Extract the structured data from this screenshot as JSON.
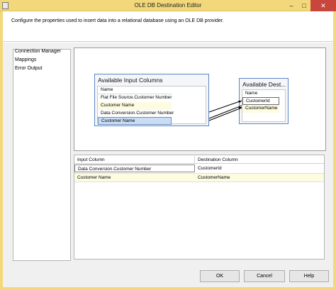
{
  "window": {
    "title": "OLE DB Destination Editor",
    "minimize_glyph": "–",
    "maximize_glyph": "□",
    "close_glyph": "✕"
  },
  "description": "Configure the properties used to insert data into a relational database using an OLE DB provider.",
  "nav": {
    "items": [
      "Connection Manager",
      "Mappings",
      "Error Output"
    ]
  },
  "mappings_canvas": {
    "input_box": {
      "title": "Available Input Columns",
      "header": "Name",
      "columns": [
        "Flat File Source.Customer Number",
        "Customer Name",
        "Data Conversion.Customer Number",
        "Customer Name"
      ]
    },
    "dest_box": {
      "title": "Available Dest...",
      "header": "Name",
      "columns": [
        "CustomerId",
        "CustomerName"
      ]
    }
  },
  "grid": {
    "headers": [
      "Input Column",
      "Destination Column"
    ],
    "rows": [
      {
        "input": "Data Conversion.Customer Number",
        "destination": "CustomerId"
      },
      {
        "input": "Customer Name",
        "destination": "CustomerName"
      }
    ]
  },
  "buttons": {
    "ok": "OK",
    "cancel": "Cancel",
    "help": "Help"
  },
  "colors": {
    "title_bar": "#f2d87a",
    "selection": "#c9ddf5",
    "highlight_row": "#fdfbe0"
  }
}
